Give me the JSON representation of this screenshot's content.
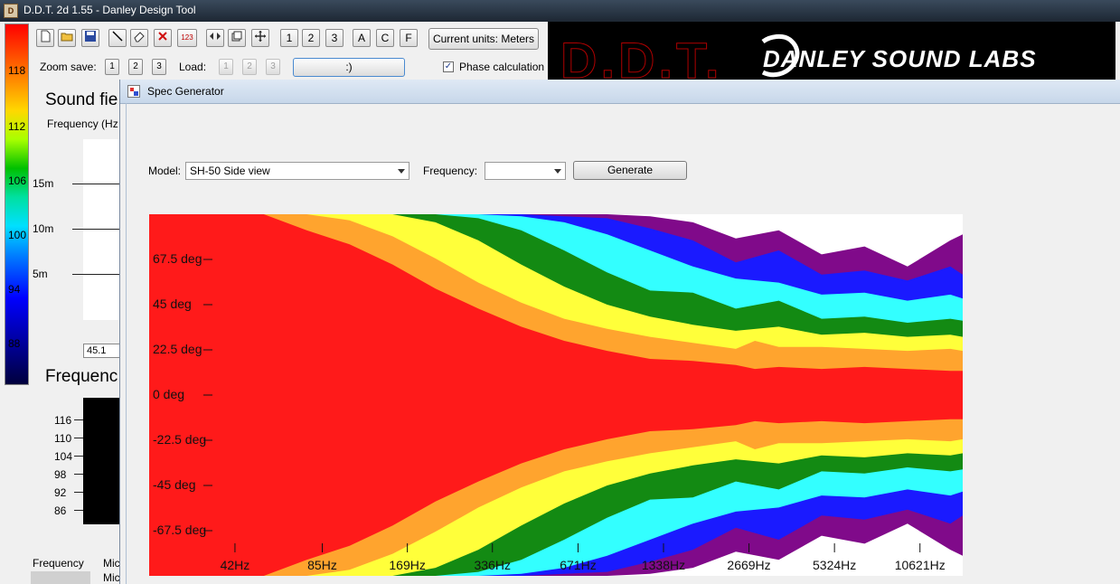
{
  "window": {
    "title": "D.D.T. 2d 1.55 - Danley Design Tool"
  },
  "legend": {
    "values": [
      "118",
      "112",
      "106",
      "100",
      "94",
      "88"
    ]
  },
  "toolbar": {
    "numbers": [
      "1",
      "2",
      "3"
    ],
    "letters": [
      "A",
      "C",
      "F"
    ],
    "current_units": "Current units: Meters",
    "zoom_save_label": "Zoom save:",
    "zoom_save_buttons": [
      "1",
      "2",
      "3"
    ],
    "load_label": "Load:",
    "load_buttons": [
      "1",
      "2",
      "3"
    ],
    "smile_button": ":)",
    "phase_label": "Phase calculation",
    "phase_checked": true
  },
  "banner": {
    "ddt": "D.D.T.",
    "danley": "DANLEY SOUND LABS"
  },
  "background": {
    "sound_field_title": "Sound fie",
    "frequency_sub": "Frequency (Hz",
    "distance_ticks": [
      "15m",
      "10m",
      "5m"
    ],
    "input_value": "45.1",
    "frequency_title": "Frequenc",
    "spl_ticks": [
      "116",
      "110",
      "104",
      "98",
      "92",
      "86"
    ],
    "frequency_label": "Frequency",
    "mid_label": "Mic",
    "mid_label2": "Mic"
  },
  "dialog": {
    "title": "Spec Generator",
    "model_label": "Model:",
    "model_value": "SH-50 Side view",
    "frequency_label": "Frequency:",
    "frequency_value": "",
    "generate_label": "Generate"
  },
  "chart_data": {
    "type": "heatmap",
    "y_tick_labels": [
      "67.5 deg",
      "45 deg",
      "22.5 deg",
      "0 deg",
      "-22.5 deg",
      "-45 deg",
      "-67.5 deg"
    ],
    "y_ticks": [
      67.5,
      45,
      22.5,
      0,
      -22.5,
      -45,
      -67.5
    ],
    "ylim": [
      -90,
      90
    ],
    "x_tick_labels": [
      "42Hz",
      "85Hz",
      "169Hz",
      "336Hz",
      "671Hz",
      "1338Hz",
      "2669Hz",
      "5324Hz",
      "10621Hz"
    ],
    "x_ticks": [
      42,
      85,
      169,
      336,
      671,
      1338,
      2669,
      5324,
      10621
    ],
    "xlim": [
      21,
      15000
    ],
    "x_scale": "log",
    "band_colors": [
      "#ff1a1a",
      "#ffa42e",
      "#ffff3a",
      "#138a13",
      "#33ffff",
      "#1a1aff",
      "#800a8a",
      "#ffffff"
    ],
    "band_boundaries_upper": [
      {
        "x": [
          21,
          53,
          75,
          106,
          150,
          212,
          300,
          424,
          600,
          849,
          1200,
          1697,
          2400,
          2800,
          3394,
          4800,
          6788,
          9600,
          13577,
          15000
        ],
        "y": [
          90,
          90,
          82,
          75,
          65,
          53,
          43,
          34,
          27,
          22,
          18,
          17,
          15,
          13,
          14,
          13,
          14,
          13,
          12,
          12
        ]
      },
      {
        "x": [
          21,
          75,
          106,
          150,
          212,
          300,
          424,
          600,
          849,
          1200,
          1697,
          2400,
          2800,
          3394,
          4800,
          6788,
          9600,
          13577,
          15000
        ],
        "y": [
          90,
          90,
          87,
          79,
          68,
          56,
          46,
          38,
          33,
          29,
          26,
          23,
          27,
          24,
          24,
          23,
          22,
          23,
          22
        ]
      },
      {
        "x": [
          21,
          150,
          212,
          300,
          424,
          600,
          849,
          1200,
          1697,
          2400,
          3394,
          4800,
          6788,
          9600,
          13577,
          15000
        ],
        "y": [
          90,
          90,
          86,
          77,
          65,
          54,
          45,
          39,
          35,
          32,
          34,
          30,
          31,
          29,
          30,
          29
        ]
      },
      {
        "x": [
          21,
          212,
          300,
          424,
          600,
          849,
          1200,
          1697,
          2400,
          3394,
          4800,
          6788,
          9600,
          13577,
          15000
        ],
        "y": [
          90,
          90,
          88,
          82,
          72,
          61,
          52,
          51,
          43,
          47,
          38,
          39,
          36,
          38,
          37
        ]
      },
      {
        "x": [
          21,
          300,
          424,
          600,
          849,
          1200,
          1697,
          2400,
          3394,
          4800,
          6788,
          9600,
          13577,
          15000
        ],
        "y": [
          90,
          90,
          89,
          86,
          80,
          72,
          64,
          58,
          56,
          50,
          51,
          47,
          50,
          48
        ]
      },
      {
        "x": [
          21,
          424,
          600,
          849,
          1200,
          1697,
          2400,
          3394,
          4800,
          6788,
          9600,
          13577,
          15000
        ],
        "y": [
          90,
          90,
          89,
          88,
          83,
          77,
          66,
          72,
          60,
          62,
          57,
          64,
          60
        ]
      },
      {
        "x": [
          21,
          849,
          1200,
          1697,
          2400,
          3394,
          4800,
          6788,
          9600,
          13577,
          15000
        ],
        "y": [
          90,
          90,
          89,
          86,
          78,
          82,
          70,
          74,
          64,
          77,
          80
        ]
      }
    ]
  }
}
